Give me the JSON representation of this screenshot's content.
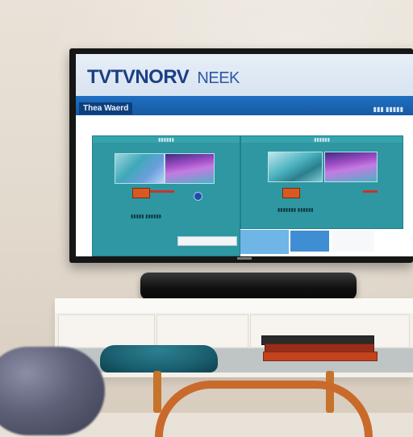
{
  "tv_screen": {
    "brand": "TVTVNORV",
    "brand_sub": "NEEK",
    "nav_title": "Thea Waerd",
    "nav_links": "▮▮▮ ▮▮▮▮▮",
    "panels": [
      {
        "title": "▮▮▮▮▮▮",
        "caption": "▮▮▮▮▮ ▮▮▮▮▮▮"
      },
      {
        "title": "▮▮▮▮▮▮",
        "caption": "▮▮▮▮▮▮▮ ▮▮▮▮▮▮"
      }
    ]
  },
  "colors": {
    "screen_header_text": "#1b3f84",
    "nav_blue": "#1f6fc2",
    "panel_teal": "#2f97a2",
    "accent_orange": "#d85a23"
  }
}
